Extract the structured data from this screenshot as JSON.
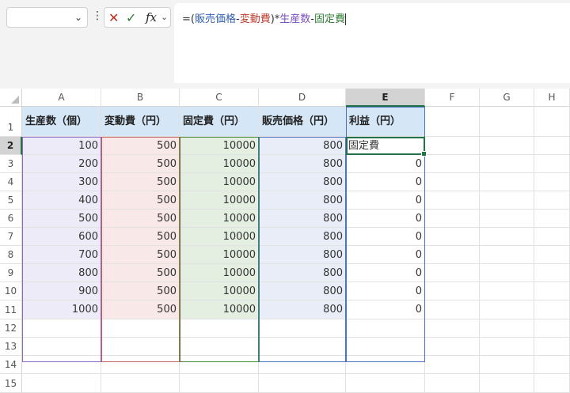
{
  "formula_bar": {
    "name_box": "",
    "formula_parts": [
      {
        "text": "=(",
        "color": "#333333"
      },
      {
        "text": "販売価格",
        "color": "#2f5fb3"
      },
      {
        "text": "-",
        "color": "#333333"
      },
      {
        "text": "変動費",
        "color": "#c0392b"
      },
      {
        "text": ")*",
        "color": "#333333"
      },
      {
        "text": "生産数",
        "color": "#7b4fbf"
      },
      {
        "text": "-",
        "color": "#333333"
      },
      {
        "text": "固定費",
        "color": "#2e7d32"
      }
    ]
  },
  "sheet": {
    "columns": [
      "A",
      "B",
      "C",
      "D",
      "E",
      "F",
      "G",
      "H"
    ],
    "row_numbers": [
      "1",
      "2",
      "3",
      "4",
      "5",
      "6",
      "7",
      "8",
      "9",
      "10",
      "11",
      "12",
      "13",
      "14",
      "15"
    ],
    "headers": [
      "生産数（個）",
      "変動費（円）",
      "固定費（円）",
      "販売価格（円）",
      "利益（円）"
    ],
    "rows": [
      [
        "100",
        "500",
        "10000",
        "800",
        "固定費"
      ],
      [
        "200",
        "500",
        "10000",
        "800",
        "0"
      ],
      [
        "300",
        "500",
        "10000",
        "800",
        "0"
      ],
      [
        "400",
        "500",
        "10000",
        "800",
        "0"
      ],
      [
        "500",
        "500",
        "10000",
        "800",
        "0"
      ],
      [
        "600",
        "500",
        "10000",
        "800",
        "0"
      ],
      [
        "700",
        "500",
        "10000",
        "800",
        "0"
      ],
      [
        "800",
        "500",
        "10000",
        "800",
        "0"
      ],
      [
        "900",
        "500",
        "10000",
        "800",
        "0"
      ],
      [
        "1000",
        "500",
        "10000",
        "800",
        "0"
      ]
    ],
    "active_cell": "E2",
    "colors": {
      "A": "#ecebf7",
      "B": "#f9e8e8",
      "C": "#e4efe2",
      "D": "#e8edf7",
      "header": "#d5e6f6",
      "accent": "#217346"
    }
  }
}
